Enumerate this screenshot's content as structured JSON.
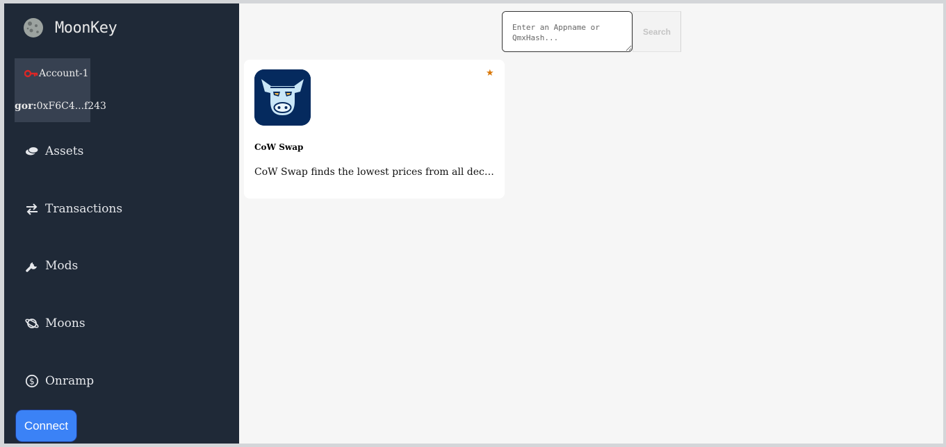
{
  "brand": {
    "name": "MoonKey",
    "logo_icon": "moon-icon"
  },
  "account": {
    "icon": "key-icon",
    "name": "Account-1",
    "network": "gor:",
    "address": "0xF6C4...f243"
  },
  "nav": {
    "items": [
      {
        "id": "assets",
        "label": "Assets",
        "icon": "coins-icon"
      },
      {
        "id": "transactions",
        "label": "Transactions",
        "icon": "swap-arrows-icon"
      },
      {
        "id": "mods",
        "label": "Mods",
        "icon": "wrench-icon"
      },
      {
        "id": "moons",
        "label": "Moons",
        "icon": "planet-icon"
      },
      {
        "id": "onramp",
        "label": "Onramp",
        "icon": "dollar-circle-icon"
      }
    ]
  },
  "connect_label": "Connect",
  "search": {
    "placeholder": "Enter an Appname or QmxHash...",
    "button_label": "Search"
  },
  "apps": [
    {
      "name": "CoW Swap",
      "description": "CoW Swap finds the lowest prices from all decentralized exchanges and DEX aggregators",
      "starred": true,
      "star_glyph": "★",
      "logo_icon": "cow-logo-icon"
    }
  ],
  "colors": {
    "sidebar_bg": "#1f2937",
    "account_bg": "#374151",
    "accent": "#3b82f6",
    "star": "#d97706",
    "app_logo_bg": "#052a5e"
  }
}
